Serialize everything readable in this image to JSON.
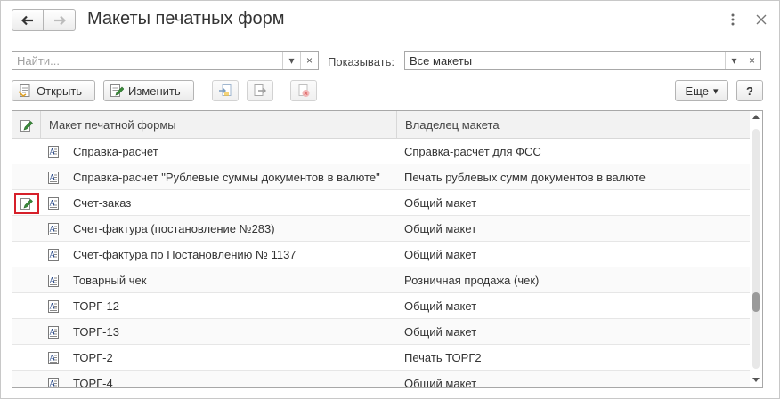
{
  "window": {
    "title": "Макеты печатных форм",
    "back_icon": "arrow-left-icon",
    "forward_icon": "arrow-right-icon",
    "menu_icon": "more-vertical-icon",
    "close_icon": "close-icon"
  },
  "filter": {
    "search_placeholder": "Найти...",
    "show_label": "Показывать:",
    "show_value": "Все макеты",
    "dropdown_glyph": "▾",
    "clear_glyph": "×"
  },
  "toolbar": {
    "open_label": "Открыть",
    "edit_label": "Изменить",
    "more_label": "Еще",
    "more_glyph": "▾",
    "help_label": "?"
  },
  "table": {
    "columns": [
      "Макет печатной формы",
      "Владелец макета"
    ],
    "rows": [
      {
        "name": "Справка-расчет",
        "owner": "Справка-расчет для ФСС",
        "modified": false
      },
      {
        "name": "Справка-расчет \"Рублевые суммы документов в валюте\"",
        "owner": "Печать рублевых сумм документов в валюте",
        "modified": false
      },
      {
        "name": "Счет-заказ",
        "owner": "Общий макет",
        "modified": true
      },
      {
        "name": "Счет-фактура (постановление №283)",
        "owner": "Общий макет",
        "modified": false
      },
      {
        "name": "Счет-фактура по Постановлению № 1137",
        "owner": "Общий макет",
        "modified": false
      },
      {
        "name": "Товарный чек",
        "owner": "Розничная продажа (чек)",
        "modified": false
      },
      {
        "name": "ТОРГ-12",
        "owner": "Общий макет",
        "modified": false
      },
      {
        "name": "ТОРГ-13",
        "owner": "Общий макет",
        "modified": false
      },
      {
        "name": "ТОРГ-2",
        "owner": "Печать ТОРГ2",
        "modified": false
      },
      {
        "name": "ТОРГ-4",
        "owner": "Общий макет",
        "modified": false
      }
    ],
    "scroll_position": 0.74
  },
  "colors": {
    "highlight_frame": "#d6202a",
    "pencil": "#3a8a3a"
  }
}
